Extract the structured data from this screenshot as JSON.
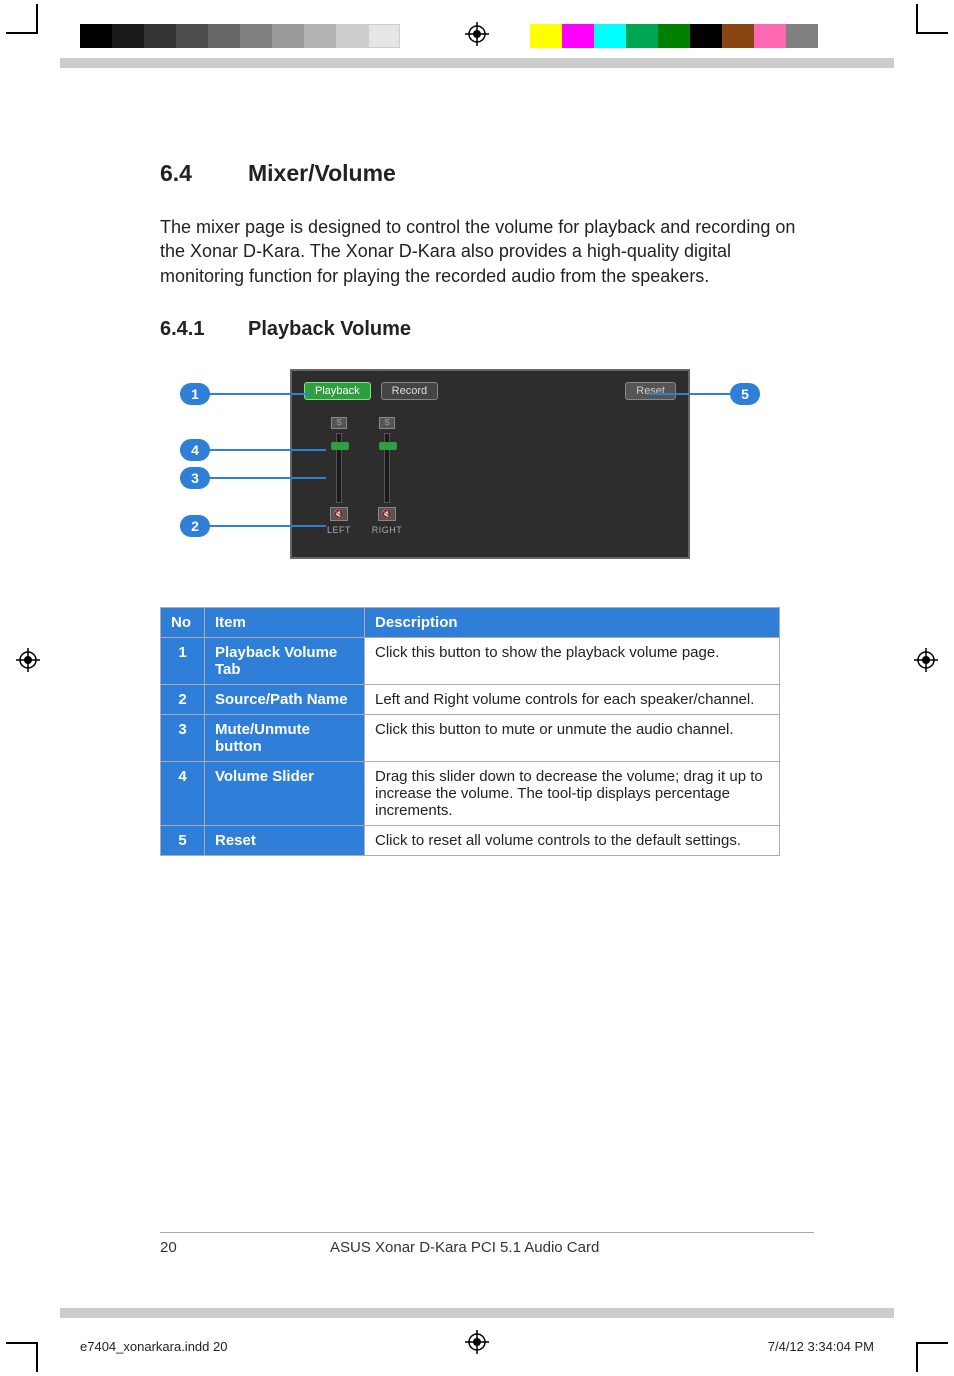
{
  "section": {
    "num": "6.4",
    "title": "Mixer/Volume"
  },
  "intro": "The mixer page is designed to control the volume for playback and recording on the Xonar D-Kara. The Xonar D-Kara also provides a high-quality digital monitoring function for playing the recorded audio from the speakers.",
  "subsection": {
    "num": "6.4.1",
    "title": "Playback Volume"
  },
  "mixer": {
    "tabs": {
      "playback": "Playback",
      "record": "Record"
    },
    "reset": "Reset",
    "channels": [
      {
        "solo": "S",
        "mute": "🔇",
        "label": "LEFT"
      },
      {
        "solo": "S",
        "mute": "🔇",
        "label": "RIGHT"
      }
    ]
  },
  "callouts": {
    "c1": "1",
    "c2": "2",
    "c3": "3",
    "c4": "4",
    "c5": "5"
  },
  "table": {
    "headers": {
      "no": "No",
      "item": "Item",
      "desc": "Description"
    },
    "rows": [
      {
        "no": "1",
        "item": "Playback Volume Tab",
        "desc": "Click this button to show the playback volume page."
      },
      {
        "no": "2",
        "item": "Source/Path Name",
        "desc": "Left and Right volume controls for each speaker/channel."
      },
      {
        "no": "3",
        "item": "Mute/Unmute button",
        "desc": "Click this button to mute or unmute the audio channel."
      },
      {
        "no": "4",
        "item": "Volume Slider",
        "desc": "Drag this slider down to decrease the volume; drag it up to increase the volume.  The tool-tip displays percentage increments."
      },
      {
        "no": "5",
        "item": "Reset",
        "desc": "Click to reset all volume controls to the default settings."
      }
    ]
  },
  "footer": {
    "pagenum": "20",
    "title": "ASUS Xonar D-Kara PCI 5.1 Audio Card"
  },
  "imposition": {
    "file": "e7404_xonarkara.indd   20",
    "date": "7/4/12   3:34:04 PM"
  },
  "marks": {
    "grays": [
      "#000",
      "#1a1a1a",
      "#333",
      "#4d4d4d",
      "#666",
      "#808080",
      "#999",
      "#b3b3b3",
      "#ccc",
      "#e6e6e6",
      "#fff"
    ],
    "colors": [
      "#ffff00",
      "#ff00ff",
      "#00ffff",
      "#00a651",
      "#008000",
      "#000000",
      "#8b4513",
      "#ff69b4",
      "#808080"
    ]
  }
}
